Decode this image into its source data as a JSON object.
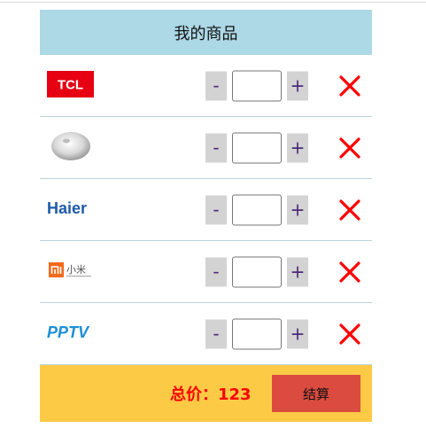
{
  "header": {
    "title": "我的商品"
  },
  "items": [
    {
      "brand": "TCL",
      "logo_icon": "tcl-logo-icon",
      "quantity": ""
    },
    {
      "brand": "",
      "logo_icon": "device-logo-icon",
      "quantity": ""
    },
    {
      "brand": "Haier",
      "logo_icon": "haier-logo-icon",
      "quantity": ""
    },
    {
      "brand": "小米",
      "logo_icon": "xiaomi-logo-icon",
      "quantity": ""
    },
    {
      "brand": "PPTV",
      "logo_icon": "pptv-logo-icon",
      "quantity": ""
    }
  ],
  "controls": {
    "minus": "-",
    "plus": "+"
  },
  "footer": {
    "total_label": "总价：",
    "total_value": "123",
    "checkout_label": "结算"
  },
  "colors": {
    "header_bg": "#add8e6",
    "footer_bg": "#fdca46",
    "checkout_bg": "#dc4b3f",
    "delete_icon": "#ff0000",
    "total_text": "#ff0000"
  }
}
